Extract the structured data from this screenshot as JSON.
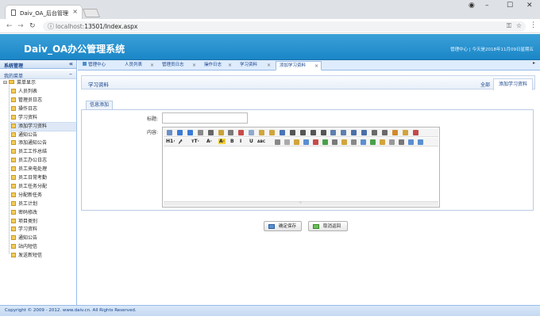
{
  "browser": {
    "tab_title": "Daiv_OA_后台管理",
    "url_host": "localhost:",
    "url_path": "13501/Index.aspx",
    "controls": {
      "minimize": "–",
      "maximize": "☐",
      "close": "✕",
      "account": "◉"
    }
  },
  "app": {
    "title": "Daiv_OA办公管理系统",
    "user_info": "管理中心 | 今天是2018年11月09日星期五"
  },
  "sidebar": {
    "title": "系统管理",
    "collapse": "«",
    "menu_title": "我的菜单",
    "menu_collapse": "–",
    "root": "菜单显示",
    "items": [
      {
        "label": "人员列表"
      },
      {
        "label": "管理员日志"
      },
      {
        "label": "操作日志"
      },
      {
        "label": "学习资料"
      },
      {
        "label": "添加学习资料",
        "selected": true
      },
      {
        "label": "通知公告"
      },
      {
        "label": "添加通知公告"
      },
      {
        "label": "员工工作总结"
      },
      {
        "label": "员工办公日志"
      },
      {
        "label": "员工来电处理"
      },
      {
        "label": "员工日常考勤"
      },
      {
        "label": "员工任务分配"
      },
      {
        "label": "分配新任务"
      },
      {
        "label": "员工计划"
      },
      {
        "label": "密码修改"
      },
      {
        "label": "项目类别"
      },
      {
        "label": "学习资料"
      },
      {
        "label": "通知公告"
      },
      {
        "label": "站内短信"
      },
      {
        "label": "发送新短信"
      }
    ]
  },
  "tabs": [
    {
      "label": "管理中心",
      "home": true
    },
    {
      "label": "人员列表"
    },
    {
      "label": "管理员日志"
    },
    {
      "label": "操作日志"
    },
    {
      "label": "学习资料"
    },
    {
      "label": "添加学习资料",
      "active": true
    }
  ],
  "tab_scroll": "▸",
  "panel": {
    "title": "学习资料",
    "all_link": "全部",
    "add_tab": "添加学习资料",
    "sub_tab": "信息添加"
  },
  "form": {
    "title_label": "标题:",
    "title_value": "",
    "content_label": "内容:",
    "toolbar_row1": [
      "source-icon",
      "undo-icon",
      "redo-icon",
      "preview-icon",
      "print-icon",
      "template-icon",
      "code-icon",
      "cut-icon",
      "copy-icon",
      "paste-icon",
      "paste-text-icon",
      "paste-word-icon",
      "align-left-icon",
      "align-center-icon",
      "align-right-icon",
      "justify-icon",
      "ordered-list-icon",
      "unordered-list-icon",
      "indent-icon",
      "outdent-icon",
      "subscript-icon",
      "superscript-icon",
      "clear-format-icon",
      "select-all-icon",
      "fullscreen-icon"
    ],
    "toolbar_row2_text": [
      "H1·",
      "𝒻·",
      "тT·",
      "A·",
      "A·",
      "B",
      "I",
      "U",
      "ABC"
    ],
    "resize_handle": "⁘"
  },
  "buttons": {
    "save": "确定保存",
    "back": "取消返回"
  },
  "footer": {
    "copyright": "Copyright © 2009 - 2012. www.daiv.cn. All Rights Reserved."
  },
  "colors": {
    "header": "#1b86c7",
    "accent": "#15428b",
    "border": "#99bbe8"
  }
}
